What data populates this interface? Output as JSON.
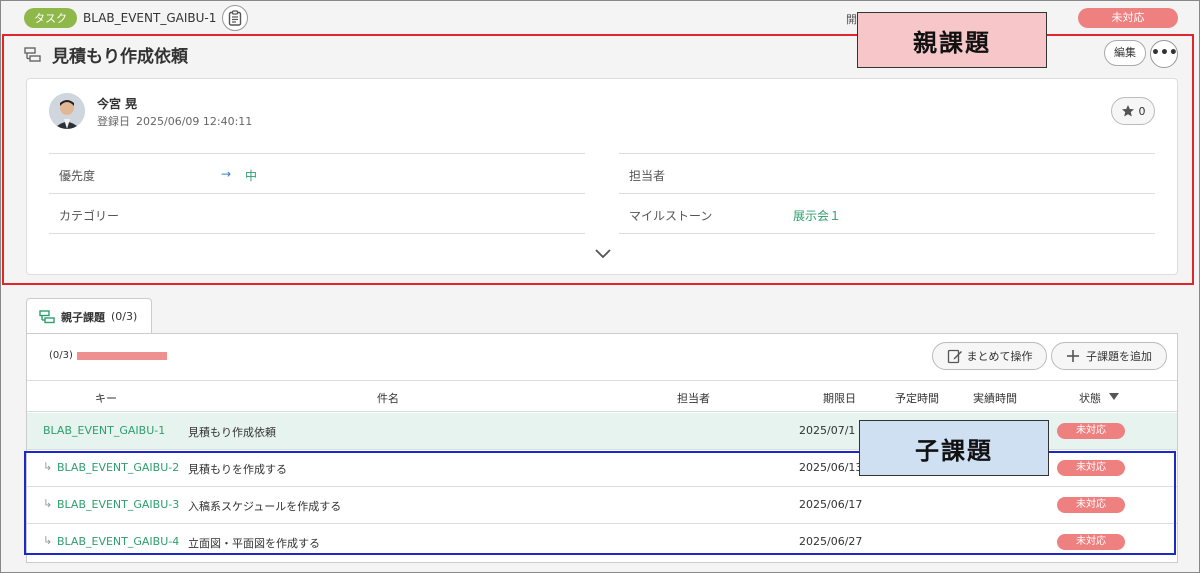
{
  "header": {
    "type_badge": "タスク",
    "issue_key": "BLAB_EVENT_GAIBU-1",
    "partial_label": "開",
    "status": "未対応"
  },
  "parent": {
    "title": "見積もり作成依頼",
    "edit_label": "編集",
    "author": "今宮 晃",
    "created_label": "登録日",
    "created_at": "2025/06/09 12:40:11",
    "star_count": "0",
    "fields": {
      "priority_label": "優先度",
      "priority_value": "中",
      "assignee_label": "担当者",
      "category_label": "カテゴリー",
      "milestone_label": "マイルストーン",
      "milestone_value": "展示会１"
    }
  },
  "children_tab": {
    "label": "親子課題",
    "count": "(0/3)"
  },
  "children_panel": {
    "progress": "(0/3)",
    "progress_fraction": 0,
    "bulk_label": "まとめて操作",
    "add_label": "子課題を追加",
    "columns": {
      "key": "キー",
      "subject": "件名",
      "assignee": "担当者",
      "due": "期限日",
      "planned": "予定時間",
      "actual": "実績時間",
      "status": "状態"
    },
    "rows": [
      {
        "key": "BLAB_EVENT_GAIBU-1",
        "subject": "見積もり作成依頼",
        "due": "2025/07/1",
        "status": "未対応"
      },
      {
        "key": "BLAB_EVENT_GAIBU-2",
        "subject": "見積もりを作成する",
        "due": "2025/06/13",
        "status": "未対応"
      },
      {
        "key": "BLAB_EVENT_GAIBU-3",
        "subject": "入稿系スケジュールを作成する",
        "due": "2025/06/17",
        "status": "未対応"
      },
      {
        "key": "BLAB_EVENT_GAIBU-4",
        "subject": "立面図・平面図を作成する",
        "due": "2025/06/27",
        "status": "未対応"
      }
    ]
  },
  "callouts": {
    "parent": "親課題",
    "child": "子課題"
  },
  "colors": {
    "accent_green": "#2e9e6e",
    "status_red": "#ee8080",
    "parent_outline": "#e0262c",
    "child_outline": "#1c29c8"
  }
}
